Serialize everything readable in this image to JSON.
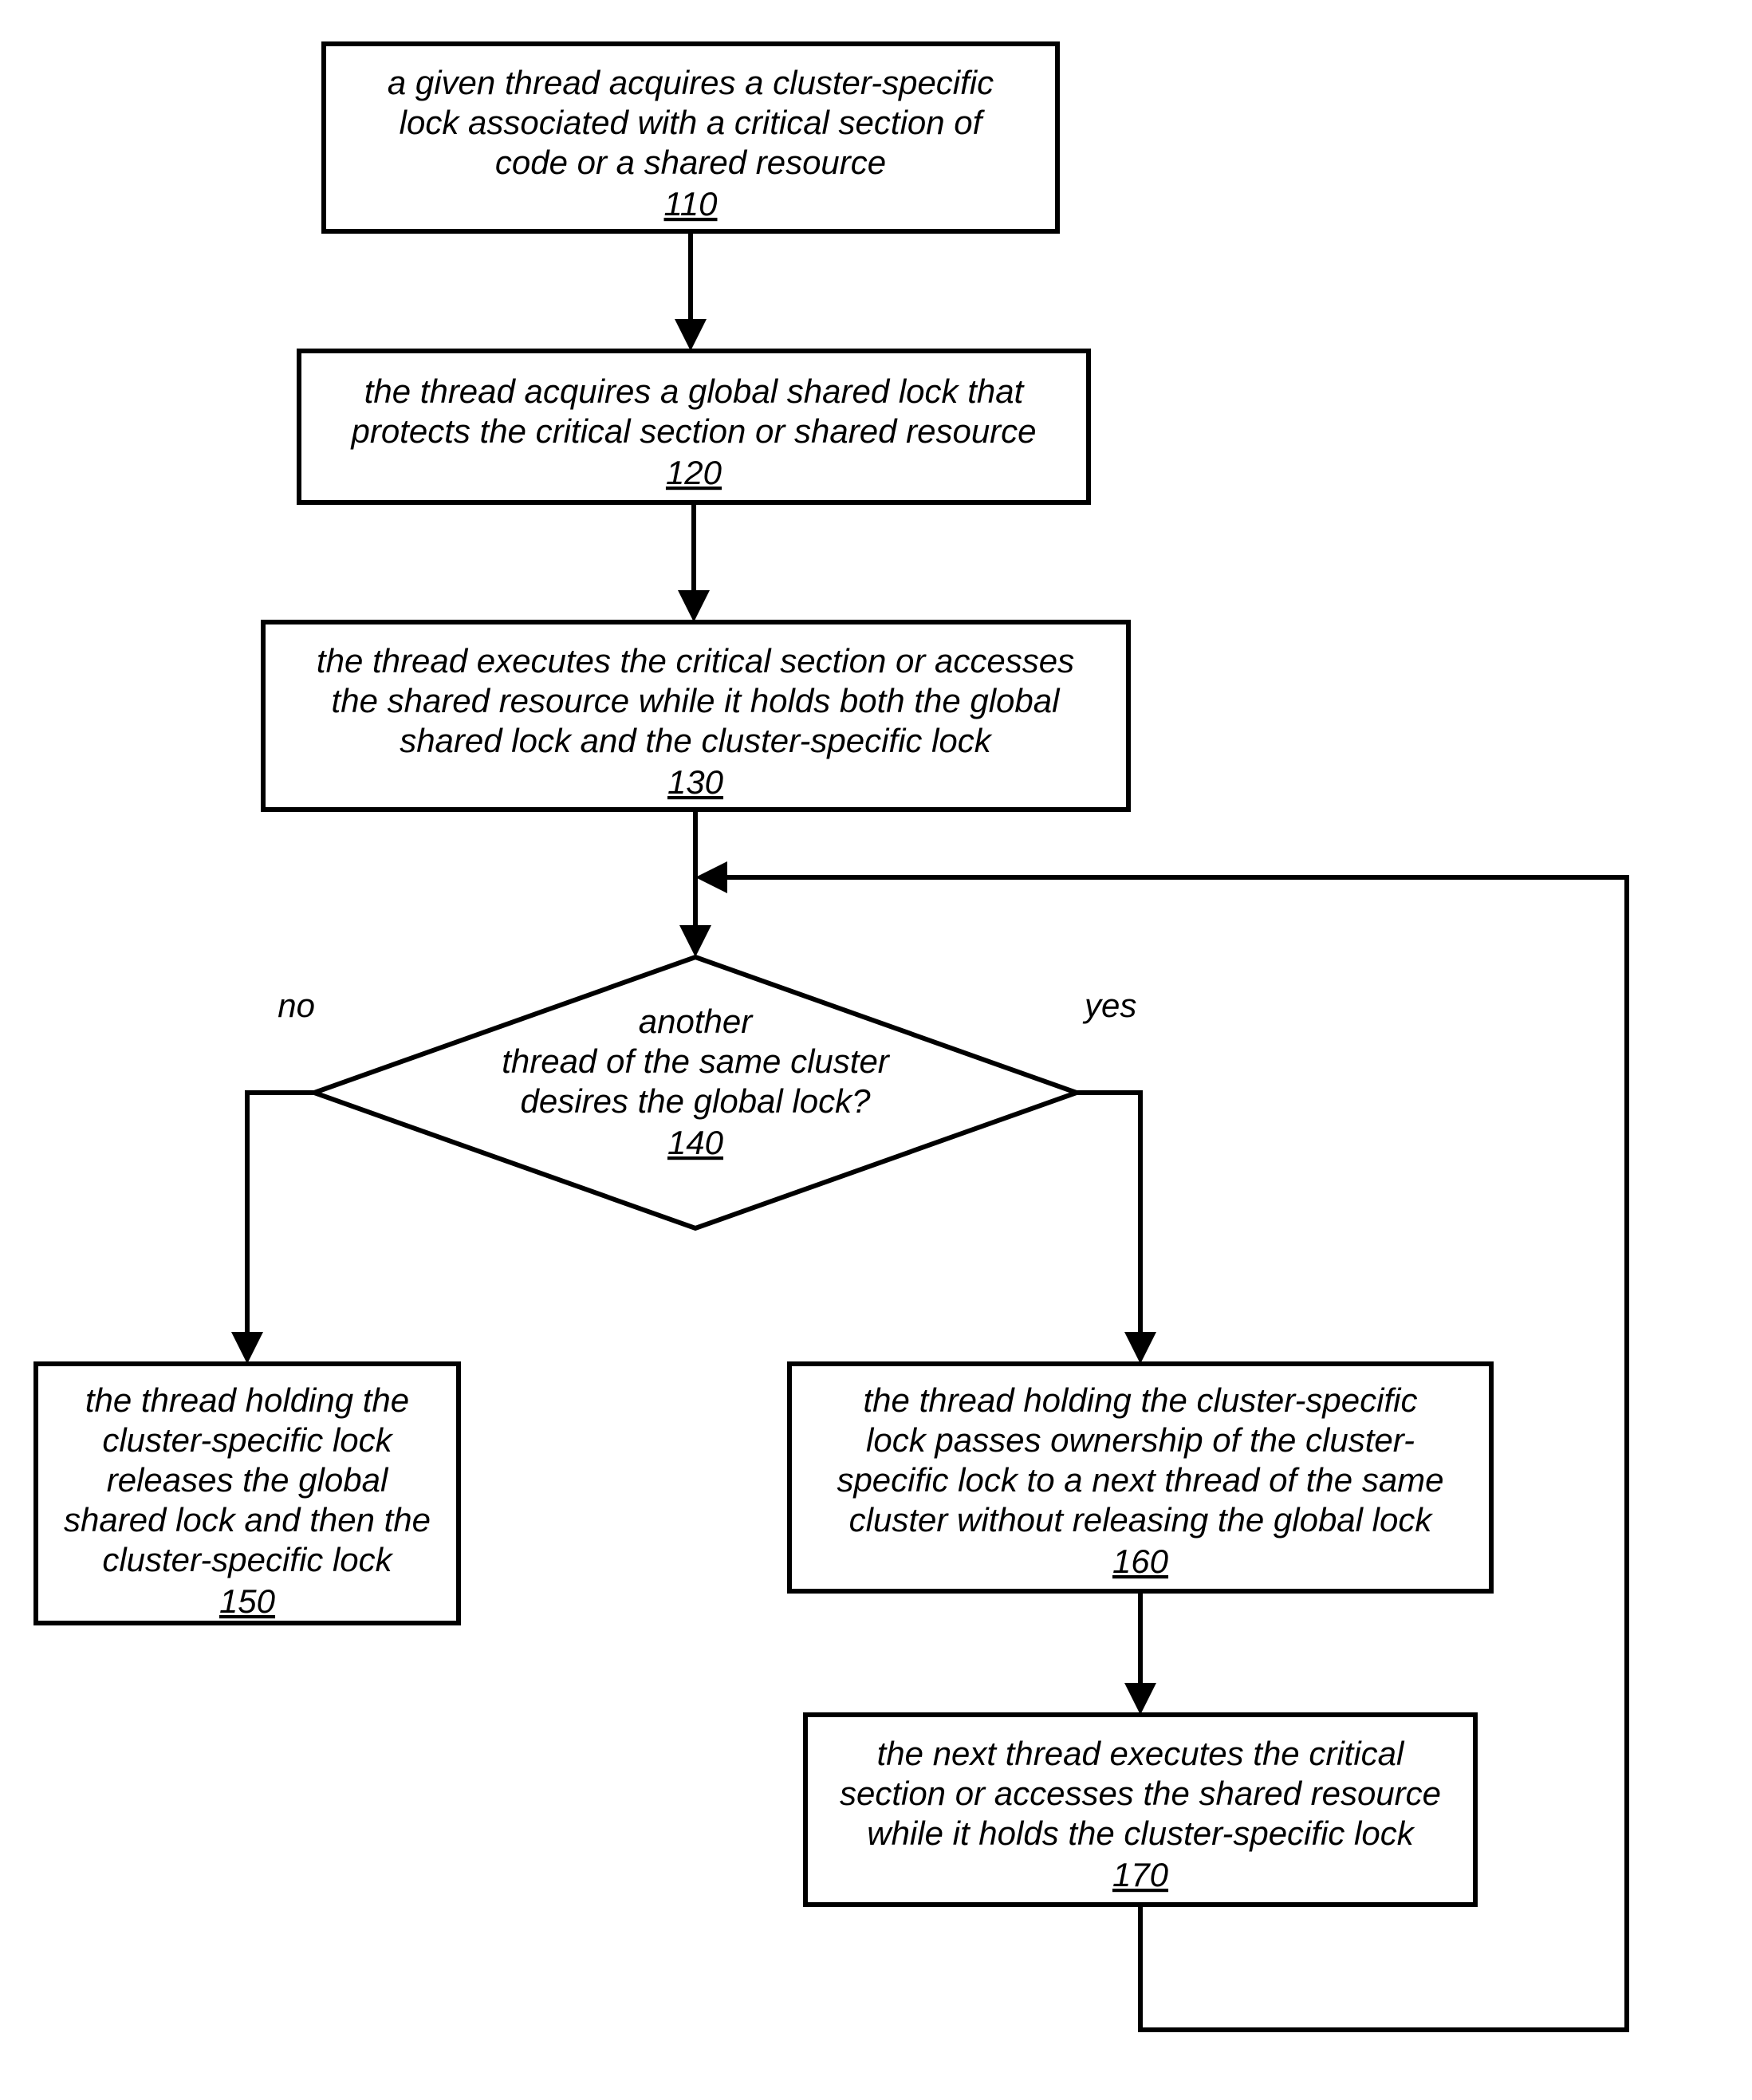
{
  "nodes": {
    "n110": {
      "lines": [
        "a given thread acquires a cluster-specific",
        "lock associated with a critical section of",
        "code or a shared resource"
      ],
      "ref": "110"
    },
    "n120": {
      "lines": [
        "the thread acquires a global shared lock that",
        "protects the critical section or shared resource"
      ],
      "ref": "120"
    },
    "n130": {
      "lines": [
        "the thread executes the critical section or accesses",
        "the shared resource while it holds both the global",
        "shared lock and the cluster-specific lock"
      ],
      "ref": "130"
    },
    "n140": {
      "lines": [
        "another",
        "thread of the same cluster",
        "desires the global lock?"
      ],
      "ref": "140"
    },
    "n150": {
      "lines": [
        "the thread holding the",
        "cluster-specific lock",
        "releases the global",
        "shared lock and then the",
        "cluster-specific lock"
      ],
      "ref": "150"
    },
    "n160": {
      "lines": [
        "the thread holding the cluster-specific",
        "lock passes ownership of the cluster-",
        "specific lock to a next thread of the same",
        "cluster without releasing the global lock"
      ],
      "ref": "160"
    },
    "n170": {
      "lines": [
        "the next thread executes the critical",
        "section or accesses the shared resource",
        "while it holds the cluster-specific lock"
      ],
      "ref": "170"
    }
  },
  "labels": {
    "no": "no",
    "yes": "yes"
  }
}
